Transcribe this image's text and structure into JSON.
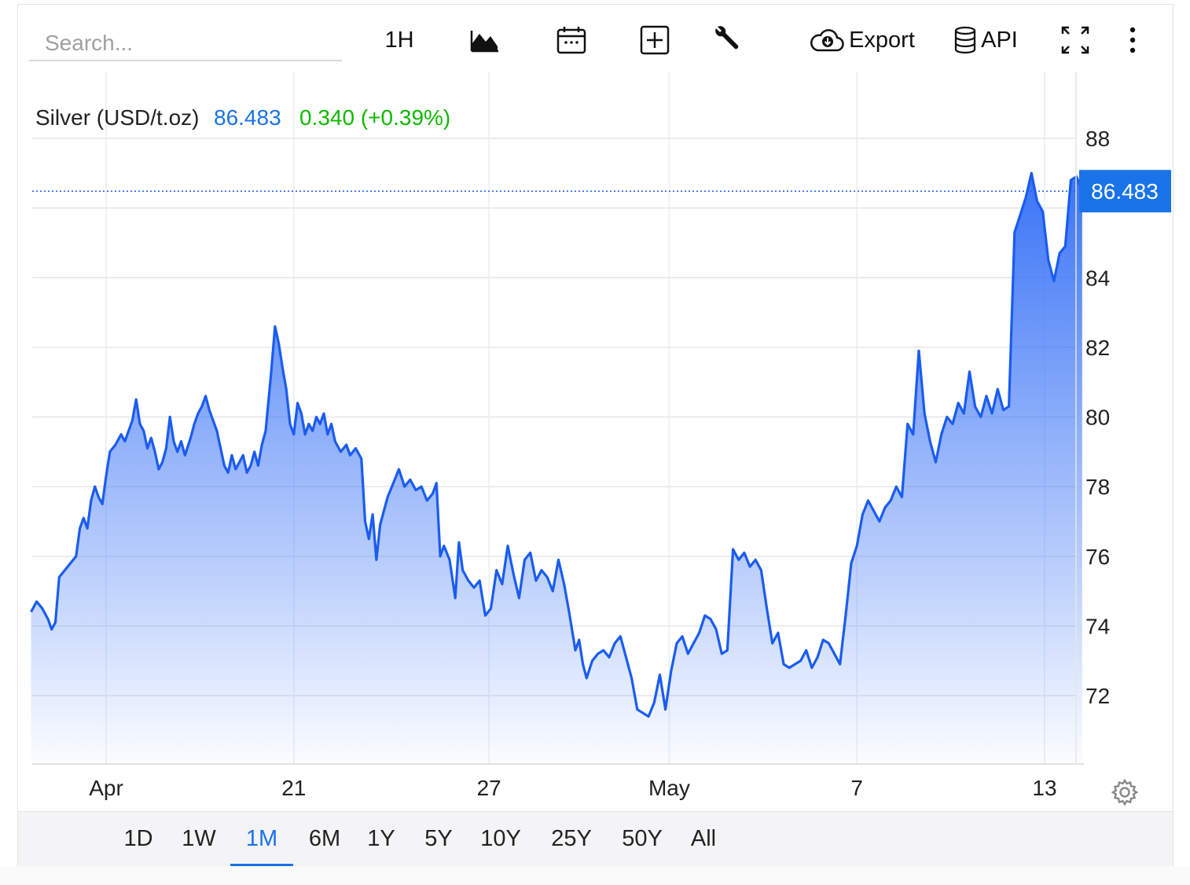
{
  "search": {
    "placeholder": "Search..."
  },
  "toolbar": {
    "interval_label": "1H",
    "chart_type_icon": "mountain-chart-icon",
    "calendar_icon": "calendar-icon",
    "add_icon": "plus-box-icon",
    "tools_icon": "wrench-icon",
    "export_label": "Export",
    "export_icon": "cloud-download-icon",
    "api_label": "API",
    "api_icon": "database-icon",
    "fullscreen_icon": "fullscreen-icon",
    "more_icon": "more-vertical-icon"
  },
  "header": {
    "instrument": "Silver (USD/t.oz)",
    "price": "86.483",
    "change": "0.340 (+0.39%)"
  },
  "price_tag": "86.483",
  "colors": {
    "line": "#1a5cf0",
    "fill_top": "#2f6cf6",
    "price_text": "#1a73e8",
    "change_text": "#11b800",
    "tag_bg": "#1a73e8",
    "active_tab": "#1a73e8"
  },
  "ranges": [
    "1D",
    "1W",
    "1M",
    "6M",
    "1Y",
    "5Y",
    "10Y",
    "25Y",
    "50Y",
    "All"
  ],
  "active_range": "1M",
  "settings_icon": "gear-icon",
  "chart_data": {
    "type": "area",
    "title": "Silver (USD/t.oz)",
    "ylim": [
      70,
      90
    ],
    "yticks": [
      72,
      74,
      76,
      78,
      80,
      82,
      84,
      86,
      88
    ],
    "ytick_labels": [
      "72",
      "74",
      "76",
      "78",
      "80",
      "82",
      "84",
      "",
      "88"
    ],
    "xlim": [
      0,
      55
    ],
    "xticks": [
      {
        "x": 4,
        "label": "Apr"
      },
      {
        "x": 14,
        "label": "21"
      },
      {
        "x": 24.4,
        "label": "27"
      },
      {
        "x": 34,
        "label": "May"
      },
      {
        "x": 44,
        "label": "7"
      },
      {
        "x": 54,
        "label": "13"
      }
    ],
    "current_value": 86.483,
    "grid": true,
    "series": [
      {
        "values": [
          [
            0,
            74.4
          ],
          [
            0.3,
            74.7
          ],
          [
            0.6,
            74.5
          ],
          [
            0.9,
            74.2
          ],
          [
            1.1,
            73.9
          ],
          [
            1.3,
            74.1
          ],
          [
            1.5,
            75.4
          ],
          [
            1.8,
            75.6
          ],
          [
            2.1,
            75.8
          ],
          [
            2.4,
            76.0
          ],
          [
            2.6,
            76.8
          ],
          [
            2.8,
            77.1
          ],
          [
            3.0,
            76.8
          ],
          [
            3.2,
            77.6
          ],
          [
            3.4,
            78.0
          ],
          [
            3.6,
            77.7
          ],
          [
            3.8,
            77.5
          ],
          [
            4.0,
            78.3
          ],
          [
            4.2,
            79.0
          ],
          [
            4.5,
            79.2
          ],
          [
            4.8,
            79.5
          ],
          [
            5.0,
            79.3
          ],
          [
            5.2,
            79.6
          ],
          [
            5.4,
            79.9
          ],
          [
            5.6,
            80.5
          ],
          [
            5.8,
            79.8
          ],
          [
            6.0,
            79.6
          ],
          [
            6.2,
            79.1
          ],
          [
            6.4,
            79.4
          ],
          [
            6.6,
            79.0
          ],
          [
            6.8,
            78.5
          ],
          [
            7.0,
            78.7
          ],
          [
            7.2,
            79.1
          ],
          [
            7.4,
            80.0
          ],
          [
            7.6,
            79.3
          ],
          [
            7.8,
            79.0
          ],
          [
            8.0,
            79.3
          ],
          [
            8.2,
            78.9
          ],
          [
            8.5,
            79.4
          ],
          [
            8.7,
            79.8
          ],
          [
            8.9,
            80.1
          ],
          [
            9.1,
            80.3
          ],
          [
            9.3,
            80.6
          ],
          [
            9.5,
            80.2
          ],
          [
            9.7,
            79.9
          ],
          [
            9.9,
            79.6
          ],
          [
            10.1,
            79.1
          ],
          [
            10.3,
            78.6
          ],
          [
            10.5,
            78.4
          ],
          [
            10.7,
            78.9
          ],
          [
            10.9,
            78.5
          ],
          [
            11.1,
            78.7
          ],
          [
            11.3,
            78.9
          ],
          [
            11.5,
            78.4
          ],
          [
            11.7,
            78.6
          ],
          [
            11.9,
            79.0
          ],
          [
            12.1,
            78.6
          ],
          [
            12.3,
            79.2
          ],
          [
            12.5,
            79.6
          ],
          [
            12.8,
            81.3
          ],
          [
            13.0,
            82.6
          ],
          [
            13.2,
            82.1
          ],
          [
            13.4,
            81.4
          ],
          [
            13.6,
            80.8
          ],
          [
            13.8,
            79.8
          ],
          [
            14.0,
            79.5
          ],
          [
            14.2,
            80.4
          ],
          [
            14.4,
            80.1
          ],
          [
            14.6,
            79.5
          ],
          [
            14.8,
            79.8
          ],
          [
            15.0,
            79.6
          ],
          [
            15.2,
            80.0
          ],
          [
            15.4,
            79.8
          ],
          [
            15.6,
            80.1
          ],
          [
            15.8,
            79.5
          ],
          [
            16.0,
            79.8
          ],
          [
            16.2,
            79.3
          ],
          [
            16.5,
            79.0
          ],
          [
            16.8,
            79.2
          ],
          [
            17.0,
            78.9
          ],
          [
            17.3,
            79.1
          ],
          [
            17.6,
            78.8
          ],
          [
            17.8,
            77.0
          ],
          [
            18.0,
            76.5
          ],
          [
            18.2,
            77.2
          ],
          [
            18.4,
            75.9
          ],
          [
            18.6,
            76.9
          ],
          [
            18.8,
            77.3
          ],
          [
            19.0,
            77.7
          ],
          [
            19.3,
            78.1
          ],
          [
            19.6,
            78.5
          ],
          [
            19.9,
            78.0
          ],
          [
            20.2,
            78.2
          ],
          [
            20.5,
            77.9
          ],
          [
            20.8,
            78.0
          ],
          [
            21.1,
            77.6
          ],
          [
            21.4,
            77.8
          ],
          [
            21.6,
            78.1
          ],
          [
            21.8,
            76.0
          ],
          [
            22.0,
            76.3
          ],
          [
            22.3,
            75.9
          ],
          [
            22.6,
            74.8
          ],
          [
            22.8,
            76.4
          ],
          [
            23.0,
            75.6
          ],
          [
            23.3,
            75.3
          ],
          [
            23.6,
            75.1
          ],
          [
            23.9,
            75.3
          ],
          [
            24.2,
            74.3
          ],
          [
            24.5,
            74.5
          ],
          [
            24.8,
            75.6
          ],
          [
            25.1,
            75.2
          ],
          [
            25.4,
            76.3
          ],
          [
            25.7,
            75.5
          ],
          [
            26.0,
            74.8
          ],
          [
            26.3,
            75.9
          ],
          [
            26.6,
            76.1
          ],
          [
            26.9,
            75.3
          ],
          [
            27.2,
            75.6
          ],
          [
            27.5,
            75.4
          ],
          [
            27.8,
            75.0
          ],
          [
            28.1,
            75.9
          ],
          [
            28.4,
            75.2
          ],
          [
            28.7,
            74.3
          ],
          [
            29.0,
            73.3
          ],
          [
            29.2,
            73.6
          ],
          [
            29.4,
            72.9
          ],
          [
            29.6,
            72.5
          ],
          [
            29.9,
            73.0
          ],
          [
            30.2,
            73.2
          ],
          [
            30.5,
            73.3
          ],
          [
            30.8,
            73.1
          ],
          [
            31.1,
            73.5
          ],
          [
            31.4,
            73.7
          ],
          [
            31.7,
            73.1
          ],
          [
            32.0,
            72.5
          ],
          [
            32.3,
            71.6
          ],
          [
            32.6,
            71.5
          ],
          [
            32.9,
            71.4
          ],
          [
            33.2,
            71.8
          ],
          [
            33.5,
            72.6
          ],
          [
            33.8,
            71.6
          ],
          [
            34.1,
            72.7
          ],
          [
            34.4,
            73.5
          ],
          [
            34.7,
            73.7
          ],
          [
            35.0,
            73.2
          ],
          [
            35.3,
            73.5
          ],
          [
            35.6,
            73.8
          ],
          [
            35.9,
            74.3
          ],
          [
            36.2,
            74.2
          ],
          [
            36.5,
            73.9
          ],
          [
            36.8,
            73.2
          ],
          [
            37.1,
            73.3
          ],
          [
            37.4,
            76.2
          ],
          [
            37.7,
            75.9
          ],
          [
            38.0,
            76.1
          ],
          [
            38.3,
            75.7
          ],
          [
            38.6,
            75.9
          ],
          [
            38.9,
            75.6
          ],
          [
            39.2,
            74.5
          ],
          [
            39.5,
            73.5
          ],
          [
            39.8,
            73.8
          ],
          [
            40.1,
            72.9
          ],
          [
            40.4,
            72.8
          ],
          [
            40.7,
            72.9
          ],
          [
            41.0,
            73.0
          ],
          [
            41.3,
            73.3
          ],
          [
            41.6,
            72.8
          ],
          [
            41.9,
            73.1
          ],
          [
            42.2,
            73.6
          ],
          [
            42.5,
            73.5
          ],
          [
            42.8,
            73.2
          ],
          [
            43.1,
            72.9
          ],
          [
            43.4,
            74.3
          ],
          [
            43.7,
            75.8
          ],
          [
            44.0,
            76.3
          ],
          [
            44.3,
            77.2
          ],
          [
            44.6,
            77.6
          ],
          [
            44.9,
            77.3
          ],
          [
            45.2,
            77.0
          ],
          [
            45.5,
            77.4
          ],
          [
            45.8,
            77.6
          ],
          [
            46.1,
            78.0
          ],
          [
            46.4,
            77.7
          ],
          [
            46.7,
            79.8
          ],
          [
            47.0,
            79.5
          ],
          [
            47.3,
            81.9
          ],
          [
            47.6,
            80.1
          ],
          [
            47.9,
            79.3
          ],
          [
            48.2,
            78.7
          ],
          [
            48.5,
            79.5
          ],
          [
            48.8,
            80.0
          ],
          [
            49.1,
            79.8
          ],
          [
            49.4,
            80.4
          ],
          [
            49.7,
            80.1
          ],
          [
            50.0,
            81.3
          ],
          [
            50.3,
            80.3
          ],
          [
            50.6,
            80.0
          ],
          [
            50.9,
            80.6
          ],
          [
            51.2,
            80.1
          ],
          [
            51.5,
            80.8
          ],
          [
            51.8,
            80.2
          ],
          [
            52.1,
            80.3
          ],
          [
            52.4,
            85.3
          ],
          [
            52.7,
            85.8
          ],
          [
            53.0,
            86.3
          ],
          [
            53.3,
            87.0
          ],
          [
            53.6,
            86.2
          ],
          [
            53.9,
            85.9
          ],
          [
            54.2,
            84.5
          ],
          [
            54.5,
            83.9
          ],
          [
            54.8,
            84.7
          ],
          [
            55.1,
            84.9
          ],
          [
            55.4,
            86.8
          ],
          [
            55.7,
            86.9
          ],
          [
            56.0,
            86.5
          ]
        ]
      }
    ]
  }
}
